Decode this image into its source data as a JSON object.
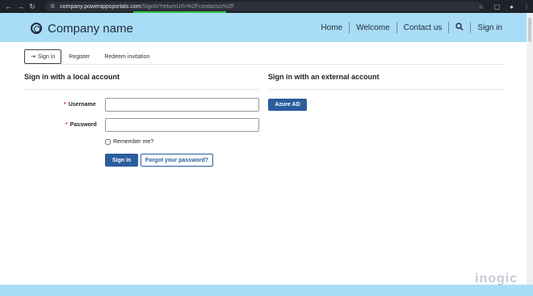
{
  "browser": {
    "url_host": "company.powerappsportals.com",
    "url_path": "/SignIn?returnUrl=%2Fcontactus%2F"
  },
  "header": {
    "company_name": "Company name",
    "nav": [
      "Home",
      "Welcome",
      "Contact us"
    ],
    "sign_in": "Sign in"
  },
  "tabs": {
    "sign_in": "Sign in",
    "register": "Register",
    "redeem": "Redeem invitation"
  },
  "local": {
    "title": "Sign in with a local account",
    "username_label": "Username",
    "password_label": "Password",
    "required_mark": "*",
    "remember_label": "Remember me?",
    "sign_in_button": "Sign in",
    "forgot_button": "Forgot your password?"
  },
  "external": {
    "title": "Sign in with an external account",
    "azure_button": "Azure AD"
  },
  "watermark": "inogic",
  "colors": {
    "header_bg": "#a9ddf7",
    "primary": "#2a5d9e",
    "required": "#c0392b"
  },
  "icons": [
    "back-icon",
    "forward-icon",
    "reload-icon",
    "site-settings-icon",
    "star-icon",
    "extensions-icon",
    "profile-icon",
    "menu-icon",
    "logo-icon",
    "search-icon",
    "sign-in-arrow-icon"
  ]
}
